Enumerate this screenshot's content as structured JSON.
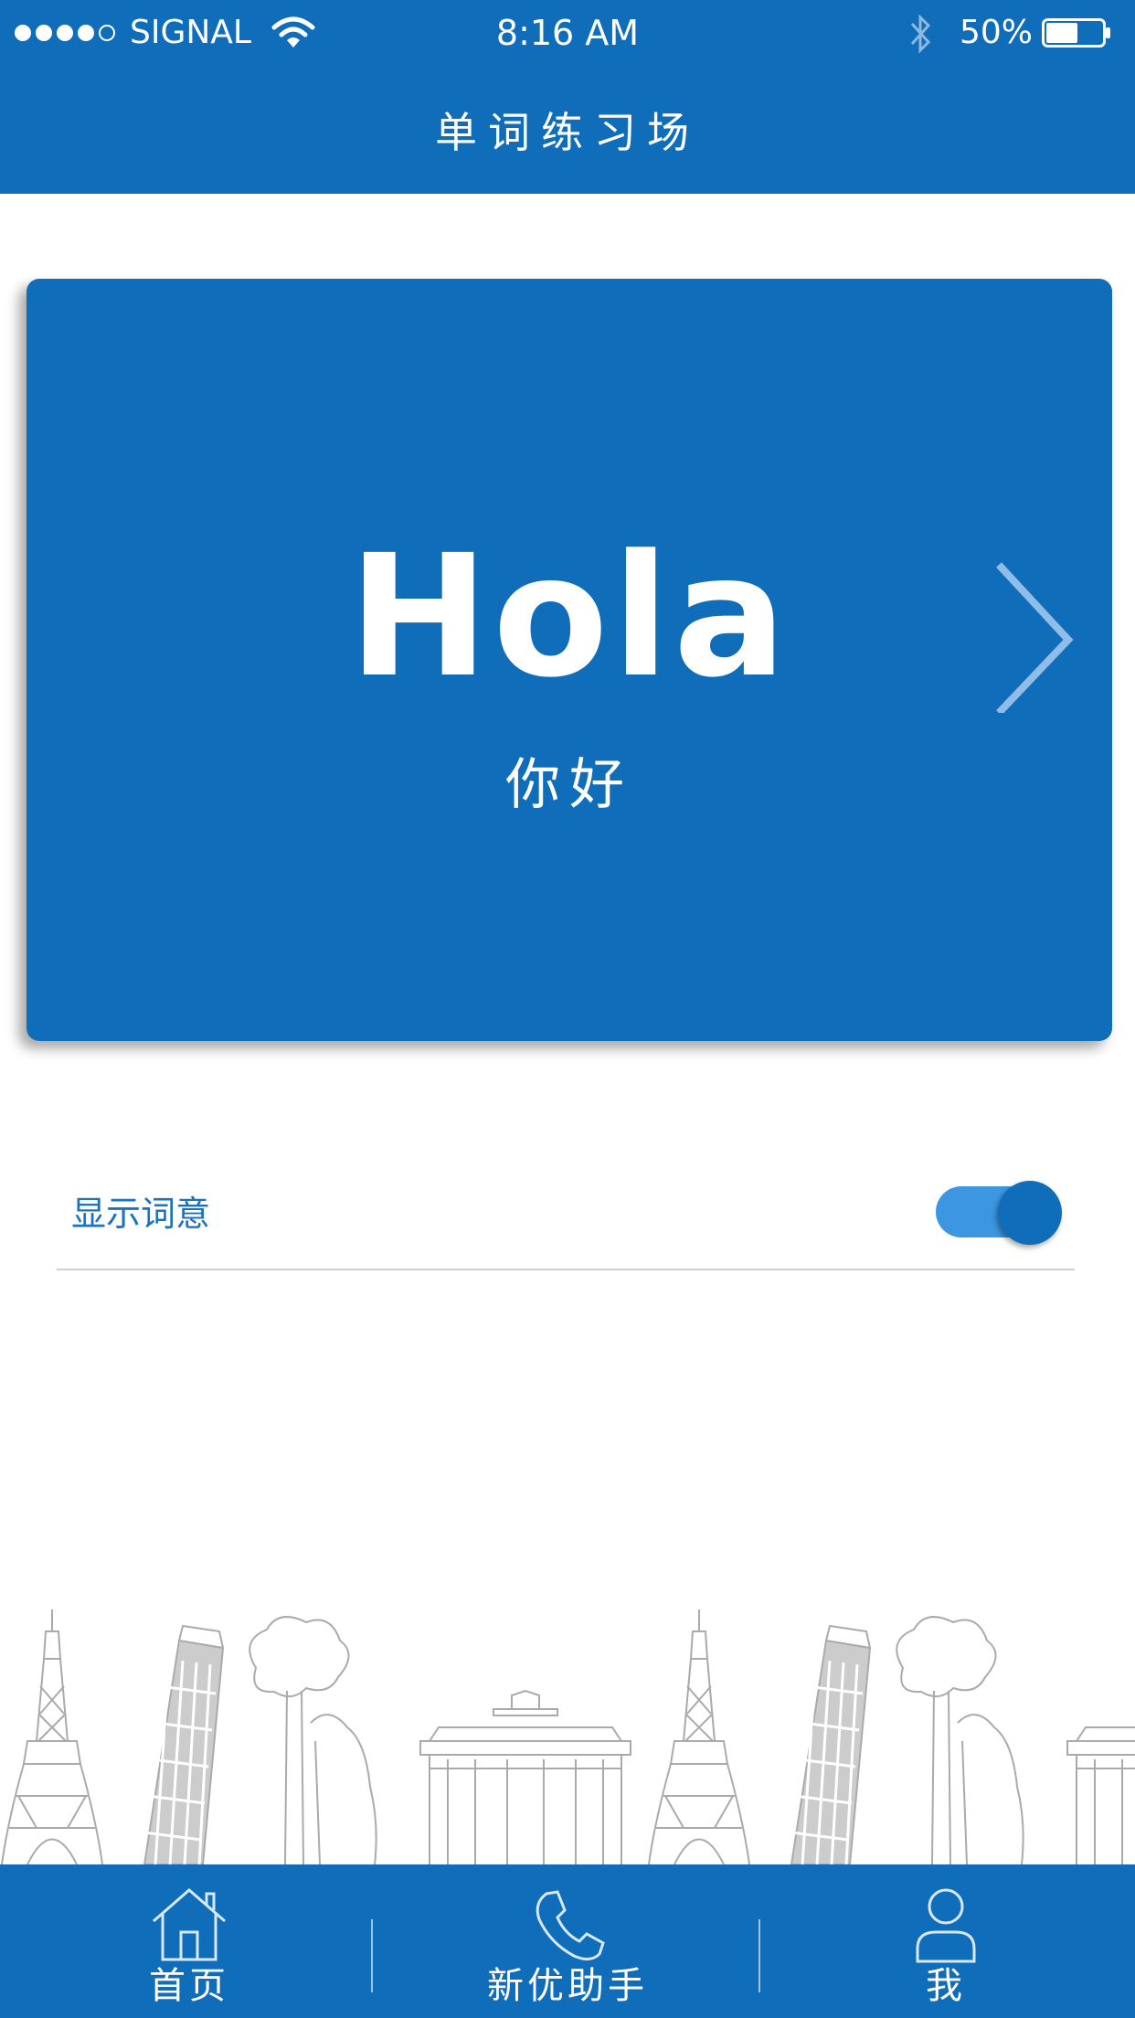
{
  "status_bar": {
    "carrier": "SIGNAL",
    "time": "8:16 AM",
    "battery": "50%",
    "battery_level": 0.5,
    "signal_bars": 4
  },
  "nav": {
    "title": "单词练习场"
  },
  "card": {
    "word": "Hola",
    "meaning": "你好",
    "next_icon": "chevron-right-icon"
  },
  "settings": {
    "show_meaning_label": "显示词意",
    "show_meaning_on": true
  },
  "tabs": [
    {
      "label": "首页",
      "icon": "home-icon"
    },
    {
      "label": "新优助手",
      "icon": "phone-icon"
    },
    {
      "label": "我",
      "icon": "user-icon"
    }
  ],
  "colors": {
    "primary": "#106db9",
    "toggle_track": "#3c97e0",
    "label_blue": "#1a73c0",
    "skyline_gray": "#aaaaaa"
  }
}
